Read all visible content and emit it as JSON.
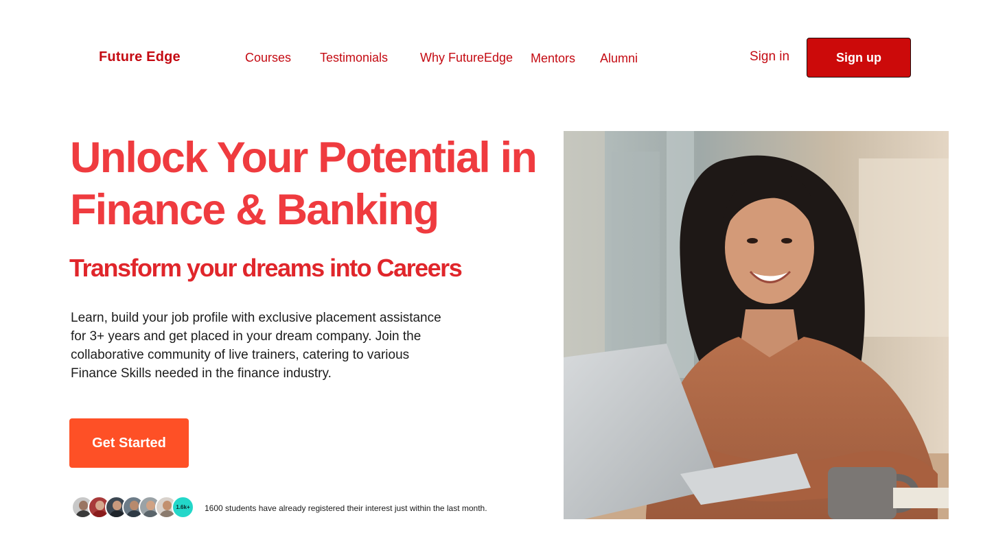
{
  "header": {
    "brand": "Future Edge",
    "nav": [
      "Courses",
      "Testimonials",
      "Why FutureEdge",
      "Mentors",
      "Alumni"
    ],
    "sign_in": "Sign in",
    "sign_up": "Sign up"
  },
  "hero": {
    "title_line1": "Unlock Your Potential in",
    "title_line2": "Finance & Banking",
    "subtitle": "Transform your dreams into Careers",
    "description": "Learn, build your job profile with exclusive placement assistance for 3+ years and get placed in your dream company. Join the collaborative community of live trainers, catering to various Finance Skills needed in the finance industry.",
    "cta": "Get Started",
    "student_count_badge": "1.6k+",
    "students_note": "1600 students have already registered their interest just within the last month."
  },
  "icons": {
    "avatars": [
      "avatar-1",
      "avatar-2",
      "avatar-3",
      "avatar-4",
      "avatar-5",
      "avatar-6"
    ],
    "hero_image": "smiling-student-with-laptop-photo"
  },
  "colors": {
    "brand_red": "#c40a12",
    "title_red": "#ef3b3f",
    "signup_bg": "#cc0a0a",
    "cta_orange": "#fe5026",
    "badge_teal": "#23d7c9"
  }
}
